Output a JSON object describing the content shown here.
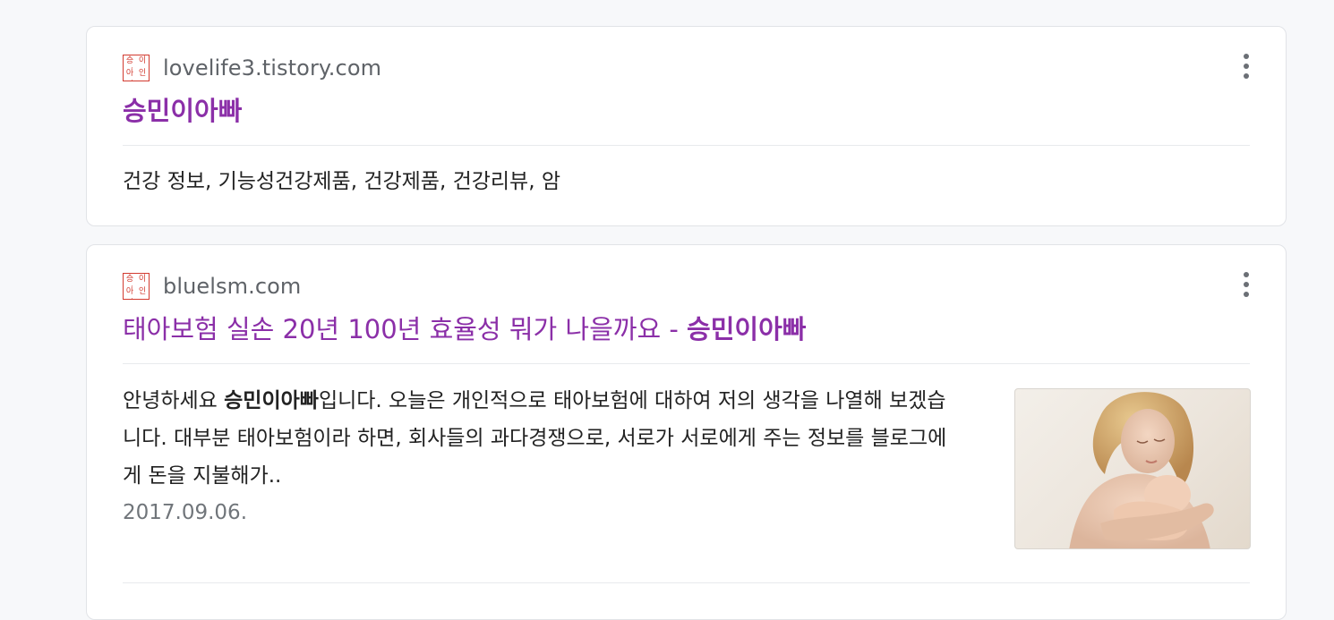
{
  "results": [
    {
      "favicon_text": [
        "승민",
        "이",
        "아빠",
        "인"
      ],
      "url": "lovelife3.tistory.com",
      "title_bold": "승민이아빠",
      "tags": "건강 정보, 기능성건강제품, 건강제품, 건강리뷰, 암"
    },
    {
      "favicon_text": [
        "승민",
        "이",
        "아빠",
        "인"
      ],
      "url": "bluelsm.com",
      "title_prefix": "태아보험 실손 20년 100년 효율성 뭐가 나을까요 - ",
      "title_bold": "승민이아빠",
      "snippet_line1_a": "안녕하세요 ",
      "snippet_bold": "승민이아빠",
      "snippet_line1_b": "입니다. 오늘은 개인적으로 태아보험에 대하여 저의 생각을 나열해 보겠습",
      "snippet_line2": "니다. 대부분 태아보험이라 하면, 회사들의 과다경쟁으로, 서로가 서로에게 주는 정보를 블로그에",
      "snippet_line3": "게 돈을 지불해가..",
      "date": "2017.09.06.",
      "thumbnail_icon": "mother-and-baby-photo"
    }
  ],
  "more_icon": "more-vertical-icon",
  "colors": {
    "title": "#8b2fa8",
    "url": "#5f6368",
    "date": "#70757a",
    "favicon": "#d23a2f"
  }
}
